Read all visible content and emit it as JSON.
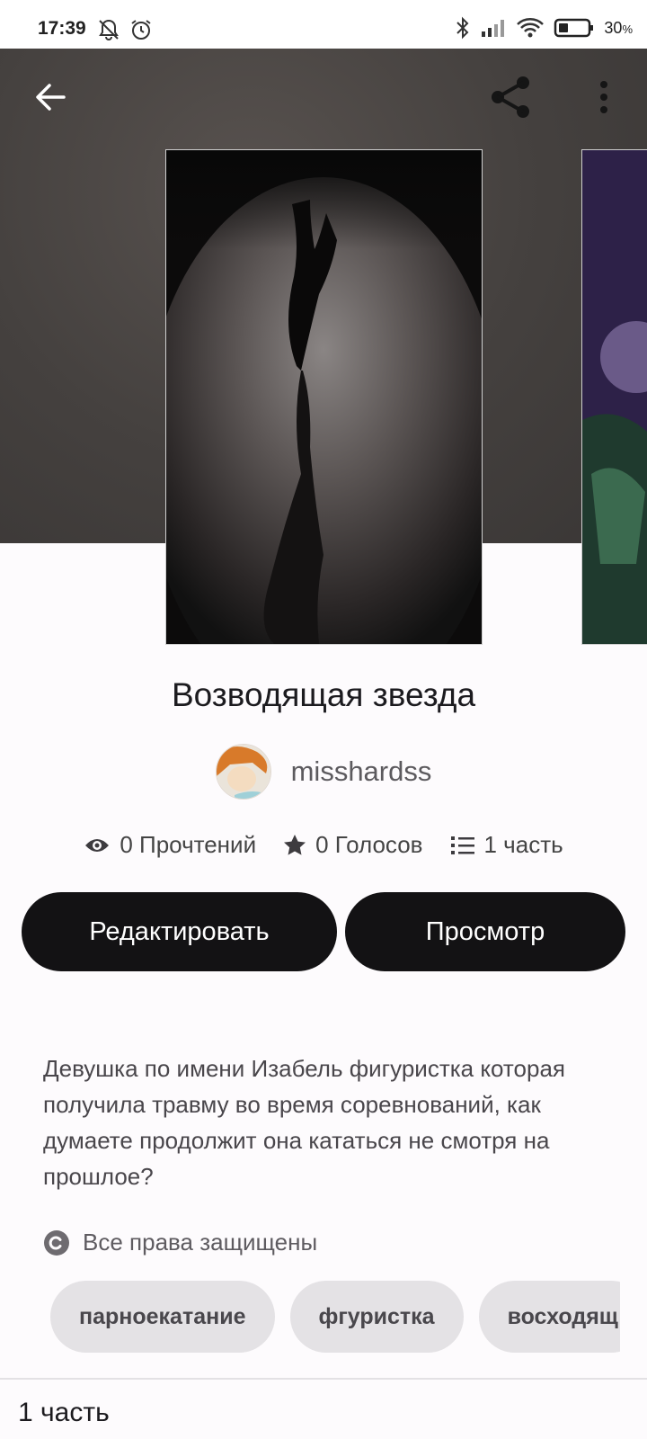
{
  "status_bar": {
    "time": "17:39",
    "battery": "30",
    "battery_unit": "%"
  },
  "story": {
    "title": "Возводящая звезда",
    "author": "misshardss",
    "stats": {
      "reads": "0 Прочтений",
      "votes": "0 Голосов",
      "parts": "1 часть"
    },
    "description": "Девушка по имени Изабель фигуристка которая получила травму во время соревнований, как думаете продолжит она кататься не смотря на прошлое?",
    "rights": "Все права защищены",
    "tags": [
      "парноекатание",
      "фгуристка",
      "восходящ"
    ]
  },
  "buttons": {
    "edit": "Редактировать",
    "view": "Просмотр"
  },
  "footer": {
    "parts_label": "1 часть"
  },
  "icons": {
    "back": "arrow-left-icon",
    "share": "share-icon",
    "more": "more-vertical-icon",
    "reads": "eye-icon",
    "votes": "star-icon",
    "parts": "list-icon",
    "rights": "copyright-icon"
  }
}
